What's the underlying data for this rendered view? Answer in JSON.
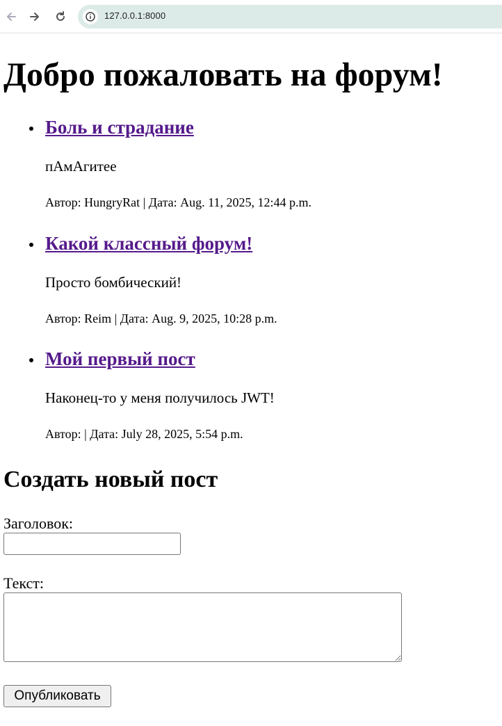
{
  "browser": {
    "url": "127.0.0.1:8000",
    "icons": {
      "back": "arrow-left-icon",
      "forward": "arrow-right-icon",
      "reload": "reload-icon",
      "site_info": "info-icon"
    }
  },
  "page": {
    "title": "Добро пожаловать на форум!",
    "link_color": "#551a8b"
  },
  "posts": [
    {
      "title": "Боль и страдание",
      "body": "пАмАгитее",
      "meta": "Автор: HungryRat | Дата: Aug. 11, 2025, 12:44 p.m."
    },
    {
      "title": "Какой классный форум!",
      "body": "Просто бомбический!",
      "meta": "Автор: Reim | Дата: Aug. 9, 2025, 10:28 p.m."
    },
    {
      "title": "Мой первый пост",
      "body": "Наконец-то у меня получилось JWT!",
      "meta": "Автор: | Дата: July 28, 2025, 5:54 p.m."
    }
  ],
  "form": {
    "heading": "Создать новый пост",
    "title_label": "Заголовок:",
    "title_value": "",
    "body_label": "Текст:",
    "body_value": "",
    "submit_label": "Опубликовать"
  }
}
